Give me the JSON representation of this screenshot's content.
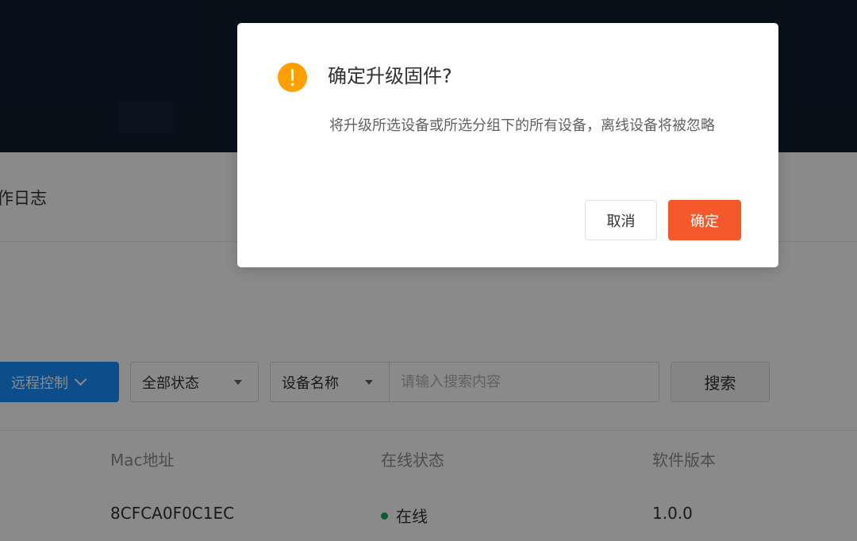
{
  "page": {
    "tab_label": "作日志",
    "toolbar": {
      "remote_control_label": "远程控制",
      "status_select_value": "全部状态",
      "field_select_value": "设备名称",
      "search_placeholder": "请输入搜索内容",
      "search_button_label": "搜索"
    },
    "table": {
      "columns": [
        "Mac地址",
        "在线状态",
        "软件版本"
      ],
      "rows": [
        {
          "mac": "8CFCA0F0C1EC",
          "status": "在线",
          "version": "1.0.0"
        }
      ]
    }
  },
  "dialog": {
    "title": "确定升级固件?",
    "message": "将升级所选设备或所选分组下的所有设备，离线设备将被忽略",
    "cancel_label": "取消",
    "confirm_label": "确定",
    "icon": "warning-icon"
  },
  "colors": {
    "primary": "#1890ff",
    "confirm": "#f5582a",
    "warning": "#ff9f00",
    "online": "#1aa564",
    "header_bg": "#0f1e31"
  }
}
